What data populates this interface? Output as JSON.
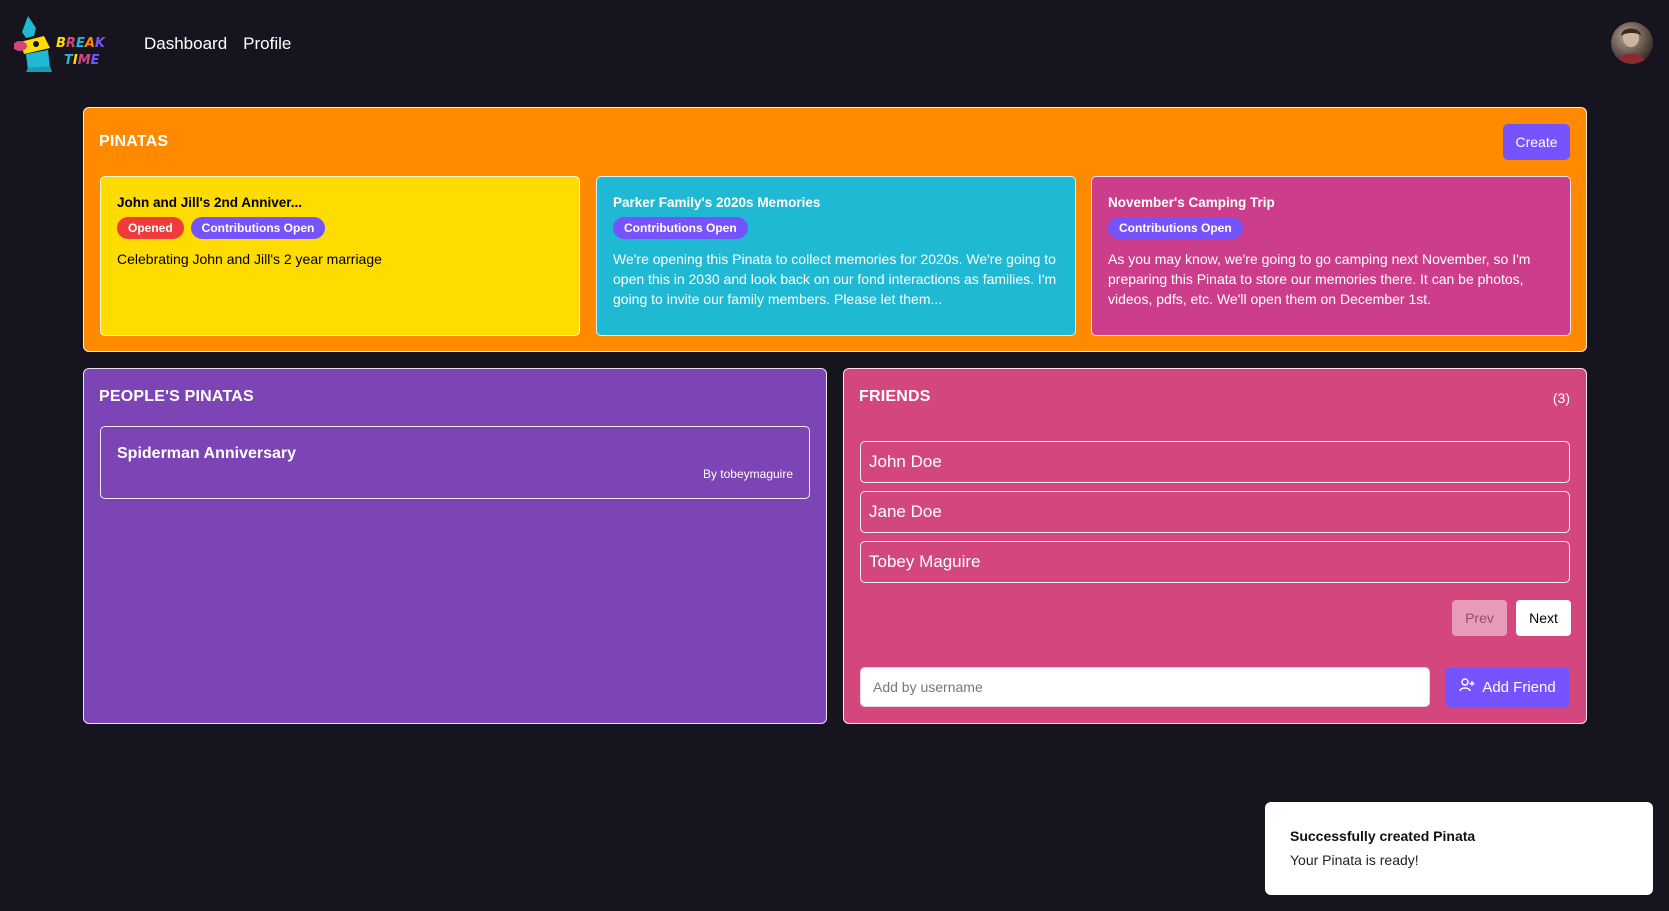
{
  "header": {
    "logo_text": "BREAK TIME",
    "nav": [
      "Dashboard",
      "Profile"
    ]
  },
  "pinatas": {
    "title": "PINATAS",
    "create_label": "Create",
    "cards": [
      {
        "title": "John and Jill's 2nd Anniver...",
        "badges": [
          "Opened",
          "Contributions Open"
        ],
        "description": "Celebrating John and Jill's 2 year marriage"
      },
      {
        "title": "Parker Family's 2020s Memories",
        "badges": [
          "Contributions Open"
        ],
        "description": "We're opening this Pinata to collect memories for 2020s. We're going to open this in 2030 and look back on our fond interactions as families. I'm going to invite our family members. Please let them..."
      },
      {
        "title": "November's Camping Trip",
        "badges": [
          "Contributions Open"
        ],
        "description": "As you may know, we're going to go camping next November, so I'm preparing this Pinata to store our memories there. It can be photos, videos, pdfs, etc. We'll open them on December 1st."
      }
    ]
  },
  "people_pinatas": {
    "title": "PEOPLE'S PINATAS",
    "items": [
      {
        "title": "Spiderman Anniversary",
        "by": "By tobeymaguire"
      }
    ]
  },
  "friends": {
    "title": "FRIENDS",
    "count": "(3)",
    "list": [
      "John Doe",
      "Jane Doe",
      "Tobey Maguire"
    ],
    "prev_label": "Prev",
    "next_label": "Next",
    "add_placeholder": "Add by username",
    "add_label": "Add Friend"
  },
  "toast": {
    "title": "Successfully created Pinata",
    "message": "Your Pinata is ready!"
  },
  "colors": {
    "background": "#16141f",
    "pinatas_panel": "#ff8a00",
    "people_panel": "#7c44b4",
    "friends_panel": "#d3477e",
    "accent": "#7553ff",
    "badge_opened": "#ef3b3b",
    "card_yellow": "#ffdc00",
    "card_cyan": "#1fb9d3",
    "card_magenta": "#cc3e8c"
  }
}
